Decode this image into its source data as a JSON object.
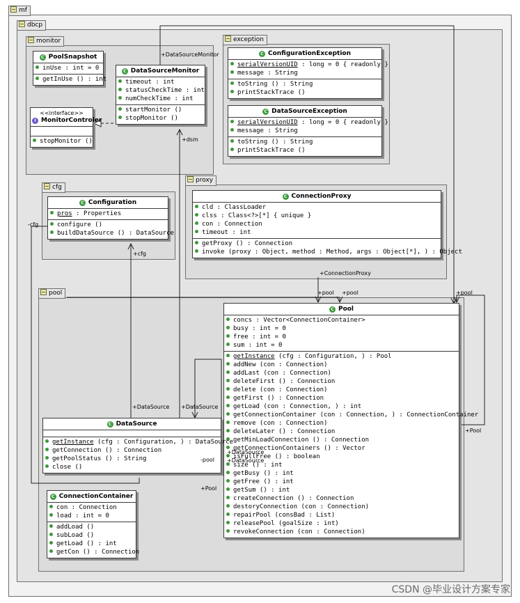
{
  "packages": {
    "mf": "mf",
    "dbcp": "dbcp",
    "monitor": "monitor",
    "exception": "exception",
    "cfg": "cfg",
    "proxy": "proxy",
    "pool": "pool"
  },
  "classes": {
    "pool_snapshot": {
      "name": "PoolSnapshot",
      "attrs": [
        "inUse : int = 0"
      ],
      "ops": [
        "getInUse () : int"
      ]
    },
    "data_source_monitor": {
      "name": "DataSourceMonitor",
      "attrs": [
        "timeout : int",
        "statusCheckTime : int",
        "numCheckTime : int"
      ],
      "ops": [
        "startMonitor ()",
        "stopMonitor ()"
      ]
    },
    "monitor_controler": {
      "stereotype": "<<interface>>",
      "name": "MonitorControler",
      "attrs": [],
      "ops": [
        "stopMonitor ()"
      ]
    },
    "configuration_exception": {
      "name": "ConfigurationException",
      "static_attr": "serialVersionUID",
      "static_attr_rest": " : long = 0 { readonly }",
      "attrs": [
        "message : String"
      ],
      "ops": [
        "toString () : String",
        "printStackTrace ()"
      ]
    },
    "data_source_exception": {
      "name": "DataSourceException",
      "static_attr": "serialVersionUID",
      "static_attr_rest": " : long = 0 { readonly }",
      "attrs": [
        "message : String"
      ],
      "ops": [
        "toString () : String",
        "printStackTrace ()"
      ]
    },
    "configuration": {
      "name": "Configuration",
      "static_attr": "pros",
      "static_attr_rest": " : Properties",
      "ops": [
        "configure ()",
        "buildDataSource () : DataSource"
      ]
    },
    "connection_proxy": {
      "name": "ConnectionProxy",
      "attrs": [
        "cld : ClassLoader",
        "clss : Class<?>[*] { unique }",
        "con : Connection",
        "timeout : int"
      ],
      "ops": [
        "getProxy () : Connection",
        "invoke (proxy : Object, method : Method, args : Object[*], ) : Object"
      ]
    },
    "pool": {
      "name": "Pool",
      "attrs": [
        "concs : Vector<ConnectionContainer>",
        "busy : int = 0",
        "free : int = 0",
        "sum : int = 0"
      ],
      "static_op": "getInstance",
      "static_op_rest": " (cfg : Configuration, ) : Pool",
      "ops": [
        "addNew (con : Connection)",
        "addLast (con : Connection)",
        "deleteFirst () : Connection",
        "delete (con : Connection)",
        "getFirst () : Connection",
        "getLoad (con : Connection, ) : int",
        "getConnectionContainer (con : Connection, ) : ConnectionContainer",
        "remove (con : Connection)",
        "deleteLater () : Connection",
        "getMinLoadConnection () : Connection",
        "getConnectionContainers () : Vector",
        "isFullFree () : boolean",
        "size () : int",
        "getBusy () : int",
        "getFree () : int",
        "getSum () : int",
        "createConnection () : Connection",
        "destoryConnection (con : Connection)",
        "repairPool (consBad : List)",
        "releasePool (goalSize : int)",
        "revokeConnection (con : Connection)"
      ]
    },
    "data_source": {
      "name": "DataSource",
      "static_op": "getInstance",
      "static_op_rest": " (cfg : Configuration, ) : DataSource",
      "ops": [
        "getConnection () : Connection",
        "getPoolStatus () : String",
        "close ()"
      ]
    },
    "connection_container": {
      "name": "ConnectionContainer",
      "attrs": [
        "con : Connection",
        "load : int = 0"
      ],
      "ops": [
        "addLoad ()",
        "subLoad ()",
        "getLoad () : int",
        "getCon () : Connection"
      ]
    }
  },
  "labels": {
    "data_source_monitor": "+DataSourceMonitor",
    "dsm": "+dsm",
    "cfg_left": "-cfg",
    "cfg": "+cfg",
    "connection_proxy": "+ConnectionProxy",
    "pool_a": "+pool",
    "pool_b": "+pool",
    "pool_c": "+pool",
    "pool_right": "+Pool",
    "data_source_a": "+DataSource",
    "data_source_b": "+DataSource",
    "data_source_c": "+DataSource",
    "data_source_d": "+DataSource",
    "pool_minus": "-pool",
    "pool_bottom": "+Pool"
  },
  "watermark": "CSDN @毕业设计方案专家"
}
